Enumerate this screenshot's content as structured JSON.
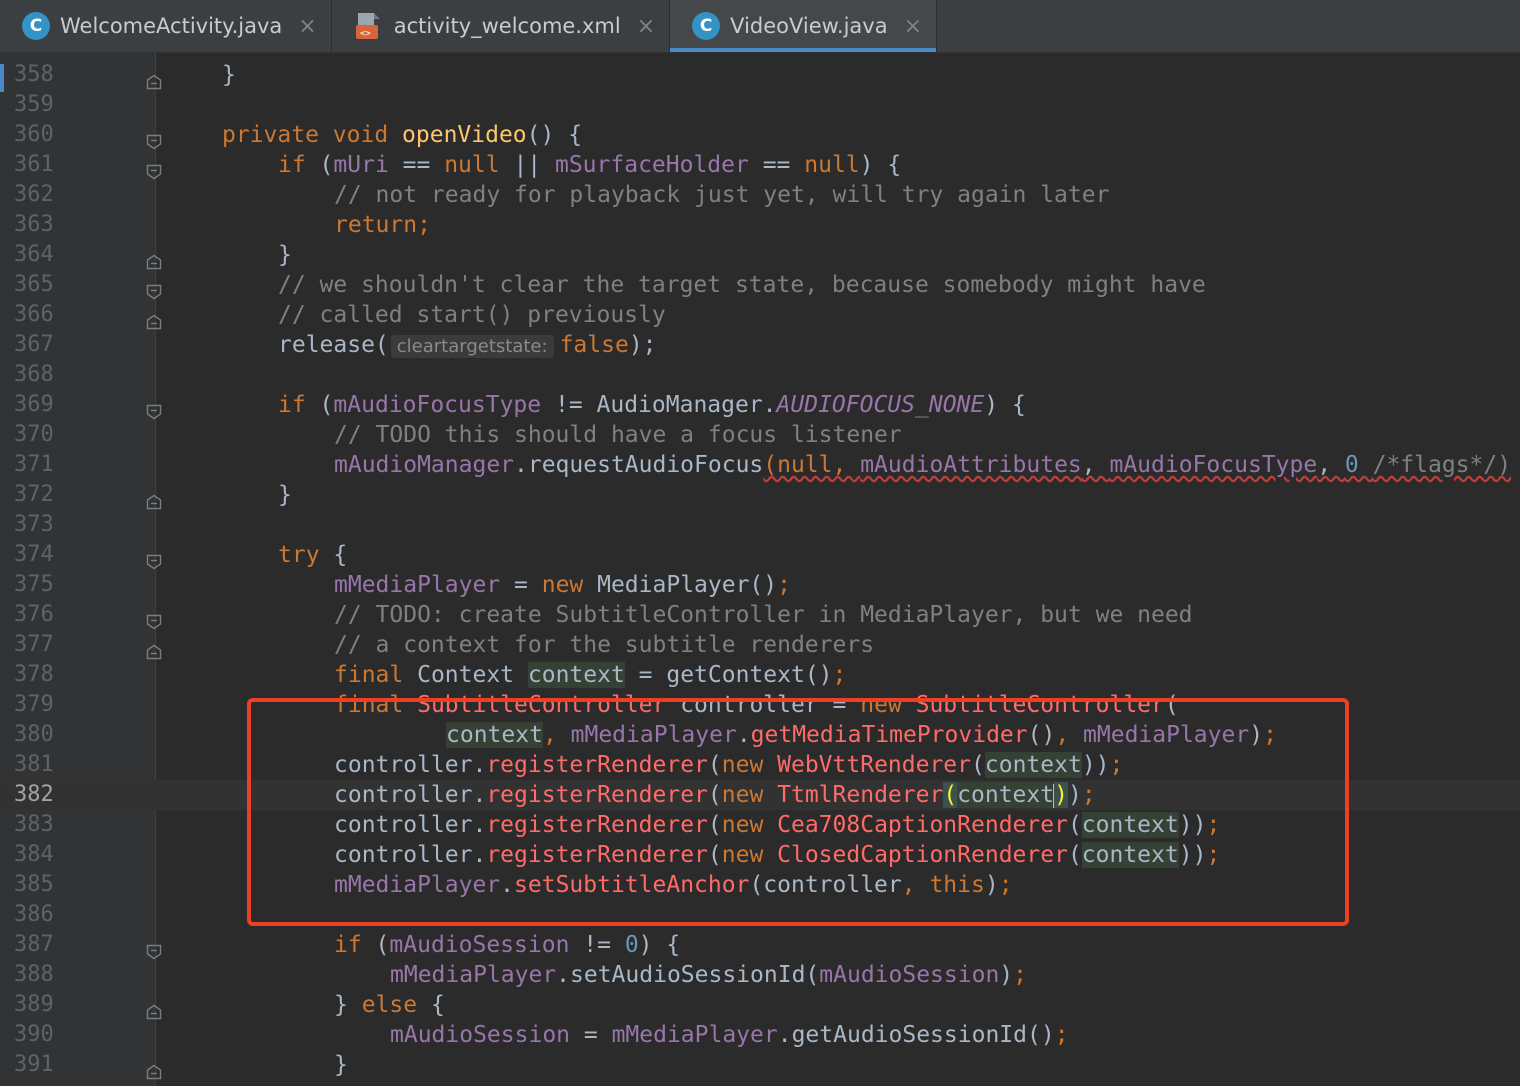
{
  "tabs": [
    {
      "label": "WelcomeActivity.java",
      "icon": "java-class-icon",
      "active": false
    },
    {
      "label": "activity_welcome.xml",
      "icon": "xml-layout-icon",
      "active": false
    },
    {
      "label": "VideoView.java",
      "icon": "java-class-icon",
      "active": true
    }
  ],
  "tab_close_glyph": "×",
  "java_icon_letter": "C",
  "colors": {
    "background": "#2b2b2b",
    "keyword": "#cc7832",
    "method": "#ffc66d",
    "field": "#9876aa",
    "comment": "#808080",
    "error": "#ff6b68",
    "annotation_box": "#ee3f24",
    "active_tab_underline": "#4a88c7"
  },
  "editor": {
    "current_line": "382",
    "lines": [
      {
        "n": "358",
        "fold": "end",
        "indent": 0,
        "parts": [
          [
            "p",
            "}"
          ]
        ]
      },
      {
        "n": "359",
        "fold": "",
        "indent": 0,
        "parts": []
      },
      {
        "n": "360",
        "fold": "start",
        "indent": 0,
        "parts": [
          [
            "kw",
            "private "
          ],
          [
            "kw",
            "void "
          ],
          [
            "fn",
            "openVideo"
          ],
          [
            "p",
            "() {"
          ]
        ]
      },
      {
        "n": "361",
        "fold": "start",
        "indent": 1,
        "parts": [
          [
            "kw",
            "if "
          ],
          [
            "p",
            "("
          ],
          [
            "fld",
            "mUri"
          ],
          [
            "p",
            " == "
          ],
          [
            "kw",
            "null "
          ],
          [
            "p",
            "|| "
          ],
          [
            "fld",
            "mSurfaceHolder"
          ],
          [
            "p",
            " == "
          ],
          [
            "kw",
            "null"
          ],
          [
            "p",
            ") {"
          ]
        ]
      },
      {
        "n": "362",
        "fold": "",
        "indent": 2,
        "parts": [
          [
            "cmt",
            "// not ready for playback just yet, will try again later"
          ]
        ]
      },
      {
        "n": "363",
        "fold": "",
        "indent": 2,
        "parts": [
          [
            "kw",
            "return;"
          ]
        ]
      },
      {
        "n": "364",
        "fold": "end",
        "indent": 1,
        "parts": [
          [
            "p",
            "}"
          ]
        ]
      },
      {
        "n": "365",
        "fold": "start",
        "indent": 1,
        "parts": [
          [
            "cmt",
            "// we shouldn't clear the target state, because somebody might have"
          ]
        ]
      },
      {
        "n": "366",
        "fold": "end",
        "indent": 1,
        "parts": [
          [
            "cmt",
            "// called start() previously"
          ]
        ]
      },
      {
        "n": "367",
        "fold": "",
        "indent": 1,
        "parts": [
          [
            "p",
            "release("
          ],
          [
            "hint",
            "cleartargetstate:"
          ],
          [
            "kw",
            "false"
          ],
          [
            "p",
            ");"
          ]
        ]
      },
      {
        "n": "368",
        "fold": "",
        "indent": 0,
        "parts": []
      },
      {
        "n": "369",
        "fold": "start",
        "indent": 1,
        "parts": [
          [
            "kw",
            "if "
          ],
          [
            "p",
            "("
          ],
          [
            "fld",
            "mAudioFocusType"
          ],
          [
            "p",
            " != AudioManager."
          ],
          [
            "cst",
            "AUDIOFOCUS_NONE"
          ],
          [
            "p",
            ") {"
          ]
        ]
      },
      {
        "n": "370",
        "fold": "",
        "indent": 2,
        "parts": [
          [
            "cmt",
            "// TODO this should have a focus listener"
          ]
        ]
      },
      {
        "n": "371",
        "fold": "",
        "indent": 2,
        "parts": [
          [
            "fld",
            "mAudioManager"
          ],
          [
            "p",
            ".requestAudioFocus"
          ],
          [
            "wkw",
            "(null, "
          ],
          [
            "wfld",
            "mAudioAttributes"
          ],
          [
            "wp",
            ", "
          ],
          [
            "wfld",
            "mAudioFocusType"
          ],
          [
            "wp",
            ", "
          ],
          [
            "wnum",
            "0 "
          ],
          [
            "wcmt",
            "/*flags*/)"
          ]
        ]
      },
      {
        "n": "372",
        "fold": "end",
        "indent": 1,
        "parts": [
          [
            "p",
            "}"
          ]
        ]
      },
      {
        "n": "373",
        "fold": "",
        "indent": 0,
        "parts": []
      },
      {
        "n": "374",
        "fold": "start",
        "indent": 1,
        "parts": [
          [
            "kw",
            "try "
          ],
          [
            "p",
            "{"
          ]
        ]
      },
      {
        "n": "375",
        "fold": "",
        "indent": 2,
        "parts": [
          [
            "fld",
            "mMediaPlayer"
          ],
          [
            "p",
            " = "
          ],
          [
            "kw",
            "new "
          ],
          [
            "p",
            "MediaPlayer()"
          ],
          [
            "kw",
            ";"
          ]
        ]
      },
      {
        "n": "376",
        "fold": "start",
        "indent": 2,
        "parts": [
          [
            "cmt",
            "// TODO: create SubtitleController in MediaPlayer, but we need"
          ]
        ]
      },
      {
        "n": "377",
        "fold": "end",
        "indent": 2,
        "parts": [
          [
            "cmt",
            "// a context for the subtitle renderers"
          ]
        ]
      },
      {
        "n": "378",
        "fold": "",
        "indent": 2,
        "parts": [
          [
            "kw",
            "final "
          ],
          [
            "p",
            "Context "
          ],
          [
            "par",
            "context"
          ],
          [
            "p",
            " = getContext()"
          ],
          [
            "kw",
            ";"
          ]
        ]
      },
      {
        "n": "379",
        "fold": "",
        "indent": 2,
        "parts": [
          [
            "kw",
            "final "
          ],
          [
            "err",
            "SubtitleController "
          ],
          [
            "p",
            "controller = "
          ],
          [
            "kw",
            "new "
          ],
          [
            "err",
            "SubtitleController"
          ],
          [
            "p",
            "("
          ]
        ]
      },
      {
        "n": "380",
        "fold": "",
        "indent": 4,
        "parts": [
          [
            "par",
            "context"
          ],
          [
            "kw",
            ", "
          ],
          [
            "fld",
            "mMediaPlayer"
          ],
          [
            "p",
            "."
          ],
          [
            "err",
            "getMediaTimeProvider"
          ],
          [
            "p",
            "()"
          ],
          [
            "kw",
            ", "
          ],
          [
            "fld",
            "mMediaPlayer"
          ],
          [
            "p",
            ")"
          ],
          [
            "kw",
            ";"
          ]
        ]
      },
      {
        "n": "381",
        "fold": "",
        "indent": 2,
        "parts": [
          [
            "p",
            "controller."
          ],
          [
            "err",
            "registerRenderer"
          ],
          [
            "p",
            "("
          ],
          [
            "kw",
            "new "
          ],
          [
            "err",
            "WebVttRenderer"
          ],
          [
            "p",
            "("
          ],
          [
            "par",
            "context"
          ],
          [
            "p",
            "))"
          ],
          [
            "kw",
            ";"
          ]
        ]
      },
      {
        "n": "382",
        "fold": "",
        "indent": 2,
        "parts": [
          [
            "p",
            "controller."
          ],
          [
            "err",
            "registerRenderer"
          ],
          [
            "p",
            "("
          ],
          [
            "kw",
            "new "
          ],
          [
            "err",
            "TtmlRenderer"
          ],
          [
            "match",
            "("
          ],
          [
            "par",
            "context"
          ],
          [
            "caret",
            ""
          ],
          [
            "match",
            ")"
          ],
          [
            "p",
            ")"
          ],
          [
            "kw",
            ";"
          ]
        ]
      },
      {
        "n": "383",
        "fold": "",
        "indent": 2,
        "parts": [
          [
            "p",
            "controller."
          ],
          [
            "err",
            "registerRenderer"
          ],
          [
            "p",
            "("
          ],
          [
            "kw",
            "new "
          ],
          [
            "err",
            "Cea708CaptionRenderer"
          ],
          [
            "p",
            "("
          ],
          [
            "par",
            "context"
          ],
          [
            "p",
            "))"
          ],
          [
            "kw",
            ";"
          ]
        ]
      },
      {
        "n": "384",
        "fold": "",
        "indent": 2,
        "parts": [
          [
            "p",
            "controller."
          ],
          [
            "err",
            "registerRenderer"
          ],
          [
            "p",
            "("
          ],
          [
            "kw",
            "new "
          ],
          [
            "err",
            "ClosedCaptionRenderer"
          ],
          [
            "p",
            "("
          ],
          [
            "par",
            "context"
          ],
          [
            "p",
            "))"
          ],
          [
            "kw",
            ";"
          ]
        ]
      },
      {
        "n": "385",
        "fold": "",
        "indent": 2,
        "parts": [
          [
            "fld",
            "mMediaPlayer"
          ],
          [
            "p",
            "."
          ],
          [
            "err",
            "setSubtitleAnchor"
          ],
          [
            "p",
            "(controller"
          ],
          [
            "kw",
            ", this"
          ],
          [
            "p",
            ")"
          ],
          [
            "kw",
            ";"
          ]
        ]
      },
      {
        "n": "386",
        "fold": "",
        "indent": 0,
        "parts": []
      },
      {
        "n": "387",
        "fold": "start",
        "indent": 2,
        "parts": [
          [
            "kw",
            "if "
          ],
          [
            "p",
            "("
          ],
          [
            "fld",
            "mAudioSession"
          ],
          [
            "p",
            " != "
          ],
          [
            "num",
            "0"
          ],
          [
            "p",
            ") {"
          ]
        ]
      },
      {
        "n": "388",
        "fold": "",
        "indent": 3,
        "parts": [
          [
            "fld",
            "mMediaPlayer"
          ],
          [
            "p",
            ".setAudioSessionId("
          ],
          [
            "fld",
            "mAudioSession"
          ],
          [
            "p",
            ")"
          ],
          [
            "kw",
            ";"
          ]
        ]
      },
      {
        "n": "389",
        "fold": "end",
        "indent": 2,
        "parts": [
          [
            "p",
            "} "
          ],
          [
            "kw",
            "else "
          ],
          [
            "p",
            "{"
          ]
        ]
      },
      {
        "n": "390",
        "fold": "",
        "indent": 3,
        "parts": [
          [
            "fld",
            "mAudioSession"
          ],
          [
            "p",
            " = "
          ],
          [
            "fld",
            "mMediaPlayer"
          ],
          [
            "p",
            ".getAudioSessionId()"
          ],
          [
            "kw",
            ";"
          ]
        ]
      },
      {
        "n": "391",
        "fold": "end",
        "indent": 2,
        "parts": [
          [
            "p",
            "}"
          ]
        ]
      }
    ]
  }
}
